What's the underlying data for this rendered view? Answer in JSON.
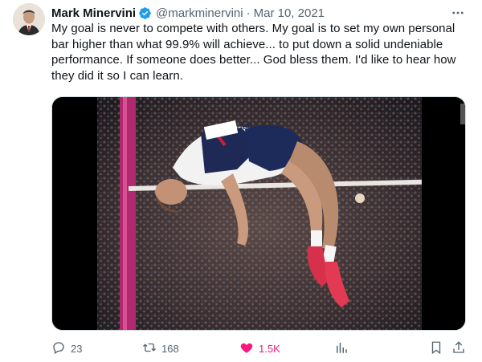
{
  "author": {
    "name": "Mark Minervini",
    "handle": "@markminervini",
    "separator": "·",
    "date": "Mar 10, 2021"
  },
  "tweet": {
    "text": "My goal is never to compete with others. My goal is to set my own personal bar higher than what 99.9% will achieve... to put down a solid undeniable performance. If someone does better... God bless them. I'd like to hear how they did it so I can learn."
  },
  "media": {
    "bib_text": "GBR"
  },
  "actions": {
    "replies": "23",
    "retweets": "168",
    "likes": "1.5K"
  },
  "colors": {
    "like_pink": "#f91880",
    "verified_blue": "#1d9bf0",
    "secondary_text": "#536471"
  },
  "icons": [
    "verified-badge-icon",
    "more-options-icon",
    "reply-icon",
    "retweet-icon",
    "like-icon",
    "views-icon",
    "bookmark-icon",
    "share-icon"
  ]
}
